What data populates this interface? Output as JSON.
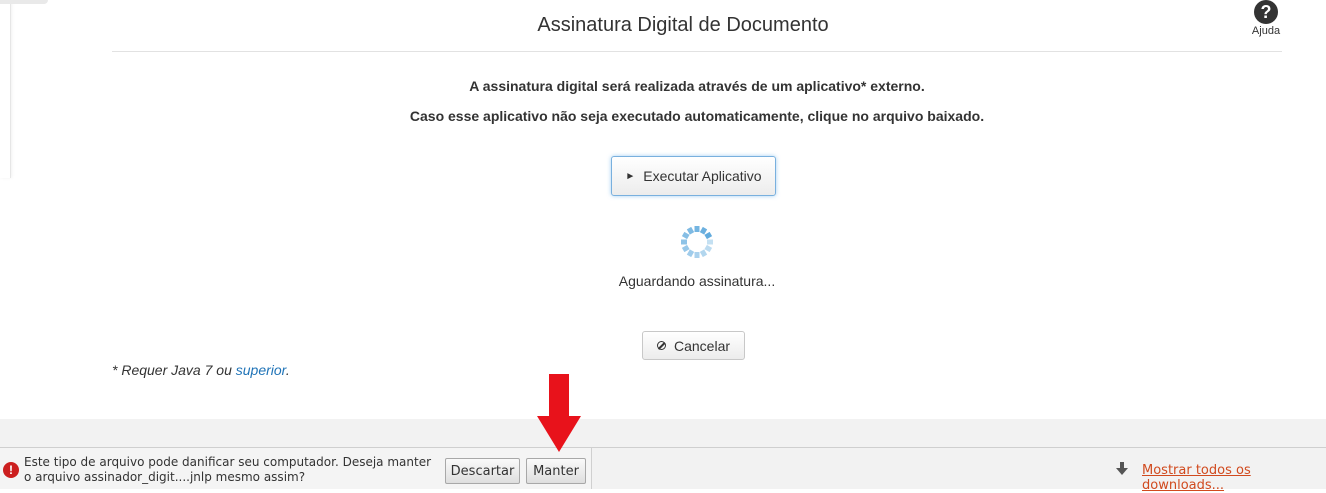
{
  "page": {
    "title": "Assinatura Digital de Documento",
    "help_label": "Ajuda",
    "help_icon": "question-circle-icon"
  },
  "messages": {
    "line1": "A assinatura digital será realizada através de um aplicativo* externo.",
    "line2": "Caso esse aplicativo não seja executado automaticamente, clique no arquivo baixado."
  },
  "actions": {
    "execute_label": "Executar Aplicativo",
    "cancel_label": "Cancelar"
  },
  "status": {
    "waiting": "Aguardando assinatura..."
  },
  "footnote": {
    "prefix": "* Requer Java 7 ou ",
    "link": "superior",
    "suffix": "."
  },
  "download_bar": {
    "warning_line1": "Este tipo de arquivo pode danificar seu computador. Deseja manter",
    "warning_line2": "o arquivo assinador_digit....jnlp mesmo assim?",
    "discard_label": "Descartar",
    "keep_label": "Manter",
    "show_all_label": "Mostrar todos os downloads..."
  },
  "colors": {
    "link": "#1f73b7",
    "warning": "#cc1f1f",
    "arrow": "#e8121b",
    "show_all": "#d14a1e",
    "spinner": "#5aa7dc"
  }
}
